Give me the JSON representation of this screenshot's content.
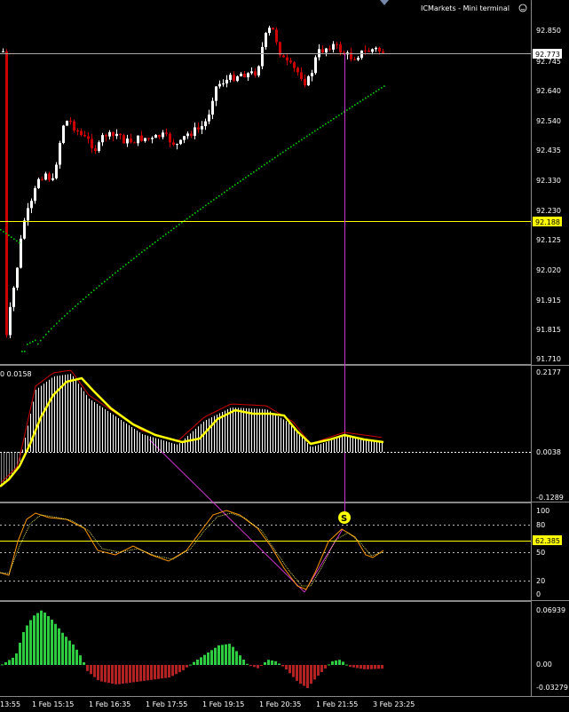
{
  "window": {
    "title": "ICMarkets - Mini terminal",
    "smiley_icon": "smiley-icon"
  },
  "colors": {
    "background": "#000000",
    "bull_candle": "#ffffff",
    "bear_candle": "#cc0000",
    "ma_line": "#00cc00",
    "yellow": "#ffff00",
    "magenta": "#cc33cc",
    "orange_line": "#ff9900",
    "hist_bear": "#b22222",
    "hist_bull": "#2ecc40",
    "grid_text": "#ffffff"
  },
  "price_panel": {
    "ticks": [
      "92.850",
      "92.745",
      "92.640",
      "92.540",
      "92.435",
      "92.330",
      "92.230",
      "92.125",
      "92.020",
      "91.915",
      "91.815",
      "91.710"
    ],
    "current_price": "92.773",
    "level_price": "92.188"
  },
  "macd_panel": {
    "header": "0 0.0158",
    "ticks": [
      "0.2177",
      "0.0038",
      "-0.1289"
    ]
  },
  "stoch_panel": {
    "ticks": [
      "100",
      "80",
      "50",
      "20",
      "0"
    ],
    "current_value": "62.385",
    "signal_label": "S"
  },
  "hist_panel": {
    "ticks": [
      "0.06939",
      "0.00",
      "-0.03279"
    ]
  },
  "time_axis": {
    "labels": [
      "13:55",
      "1 Feb 15:15",
      "1 Feb 16:35",
      "1 Feb 17:55",
      "1 Feb 19:15",
      "1 Feb 20:35",
      "1 Feb 21:55",
      "3 Feb 23:25"
    ]
  }
}
